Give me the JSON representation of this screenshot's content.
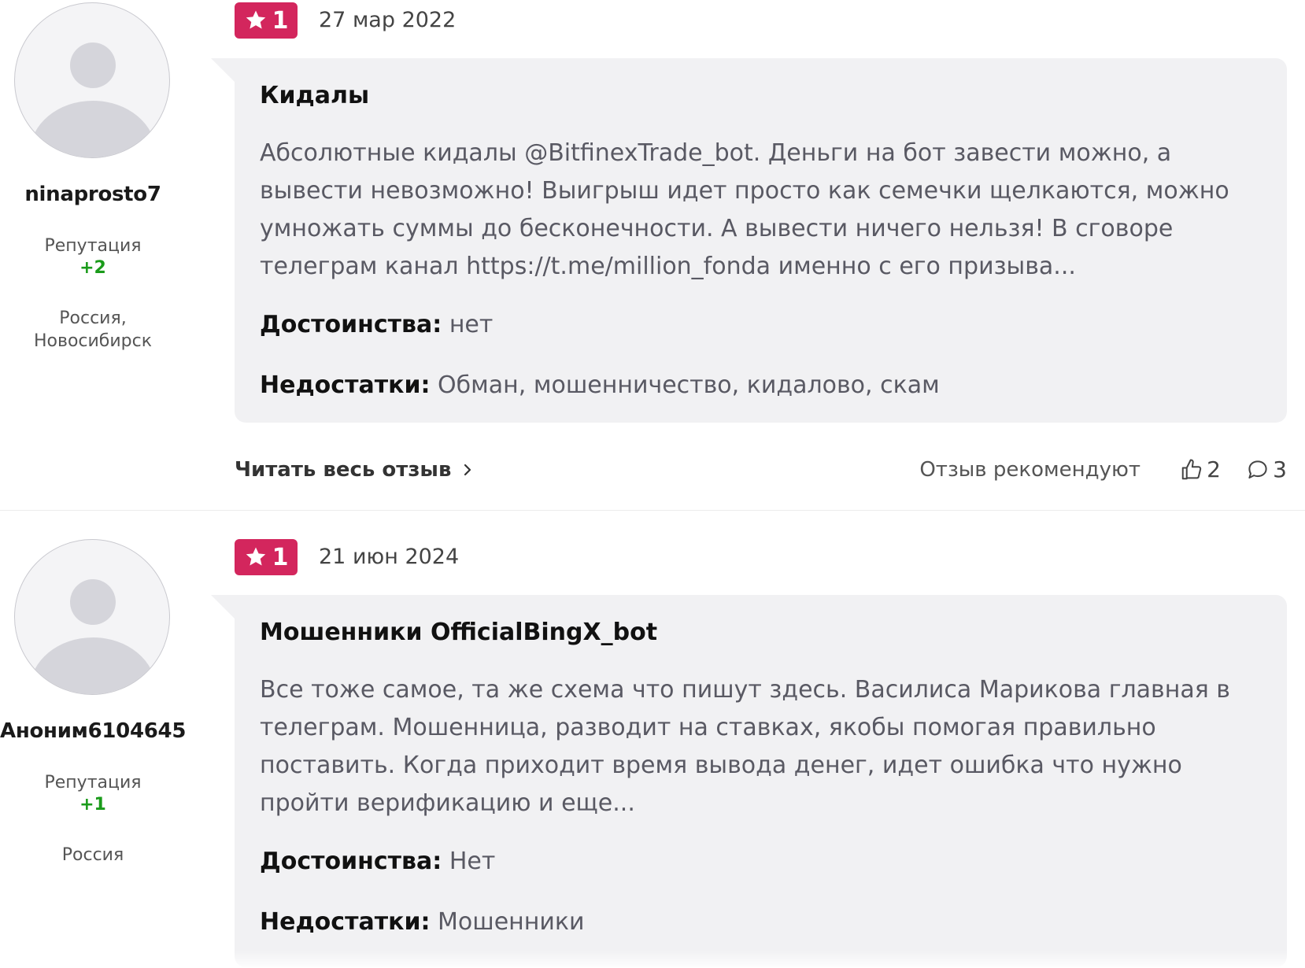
{
  "reviews": [
    {
      "user": {
        "name": "ninaprosto7",
        "reputation_label": "Репутация",
        "reputation": "+2",
        "location": "Россия, Новосибирск"
      },
      "rating": "1",
      "date": "27 мар 2022",
      "title": "Кидалы",
      "text": "Абсолютные кидалы @BitfinexTrade_bot. Деньги на бот завести можно, а вывести невозможно! Выигрыш идет просто как семечки щелкаются, можно умножать суммы до бесконечности. А вывести ничего нельзя! В сговоре телеграм канал https://t.me/million_fonda именно с его призыва...",
      "pros_label": "Достоинства:",
      "pros": "нет",
      "cons_label": "Недостатки:",
      "cons": "Обман, мошенничество, кидалово, скам",
      "read_more": "Читать весь отзыв",
      "recommend_label": "Отзыв рекомендуют",
      "likes": "2",
      "comments": "3"
    },
    {
      "user": {
        "name": "Аноним6104645",
        "reputation_label": "Репутация",
        "reputation": "+1",
        "location": "Россия"
      },
      "rating": "1",
      "date": "21 июн 2024",
      "title": "Мошенники OfficialBingX_bot",
      "text": "Все тоже самое, та же схема что пишут здесь. Василиса Марикова главная в телеграм. Мошенница, разводит на ставках, якобы помогая правильно поставить. Когда приходит время вывода денег, идет ошибка что нужно пройти верификацию и еще...",
      "pros_label": "Достоинства:",
      "pros": "Нет",
      "cons_label": "Недостатки:",
      "cons": "Мошенники"
    }
  ],
  "icons": {
    "avatar": "user-placeholder-icon",
    "rating": "star-icon",
    "read_more": "chevron-right-icon",
    "likes": "thumbs-up-icon",
    "comments": "comment-bubble-icon"
  },
  "colors": {
    "rating_badge": "#d3265d",
    "reputation_positive": "#1a9b1a",
    "bubble_bg": "#f1f1f3"
  }
}
